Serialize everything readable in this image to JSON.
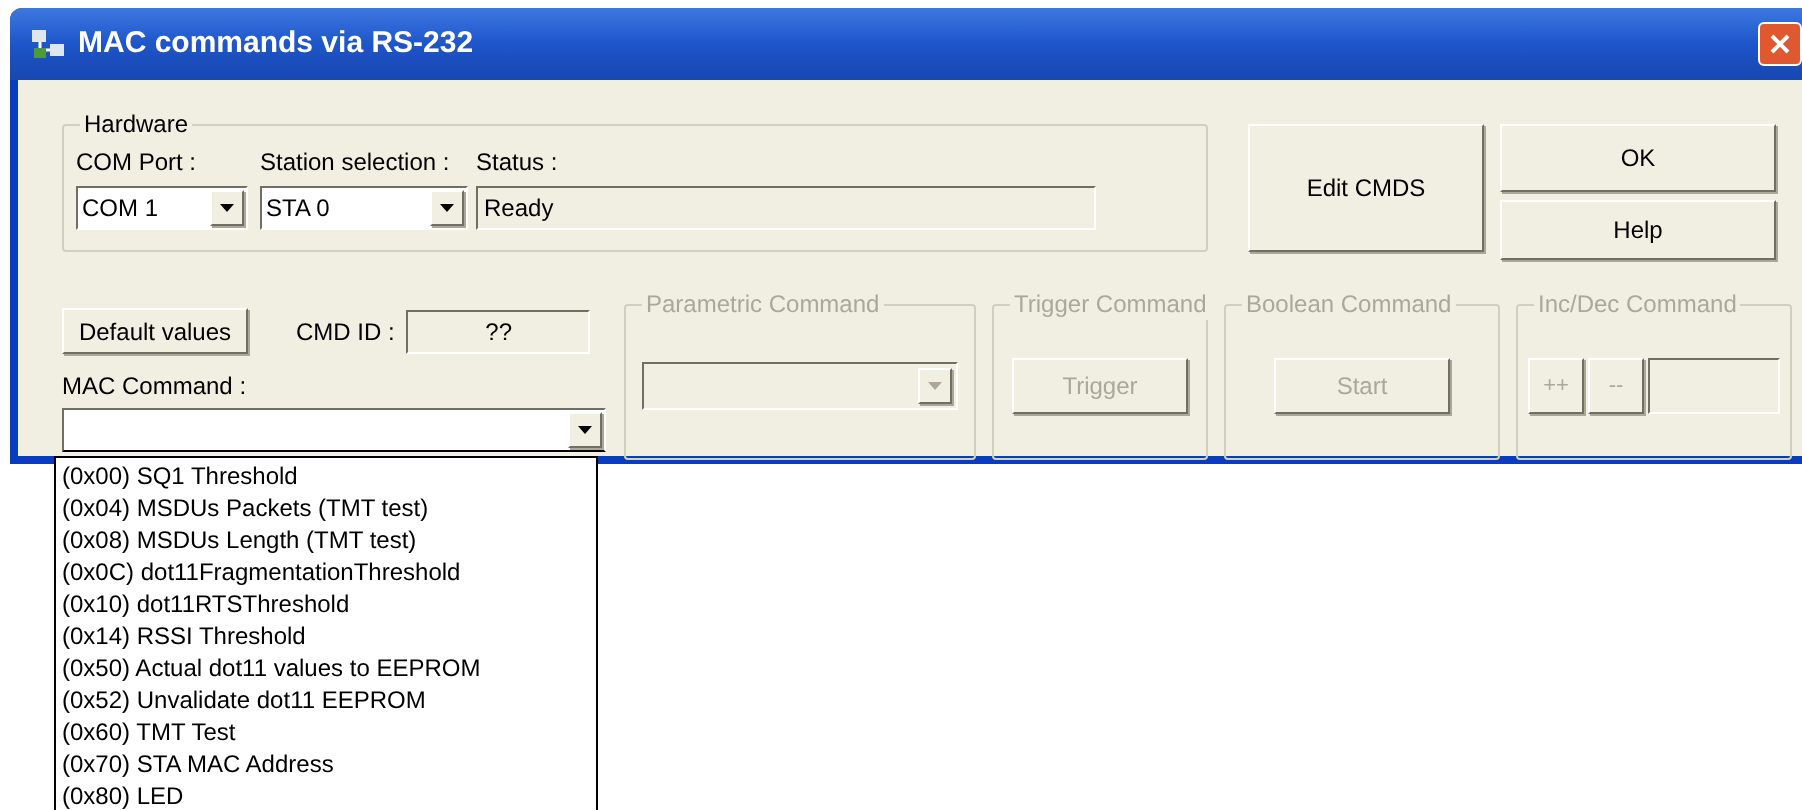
{
  "window": {
    "title": "MAC commands via RS-232"
  },
  "hardware": {
    "title": "Hardware",
    "com_port": {
      "label": "COM Port :",
      "value": "COM 1"
    },
    "station": {
      "label": "Station selection :",
      "value": "STA 0"
    },
    "status": {
      "label": "Status :",
      "value": "Ready"
    }
  },
  "buttons": {
    "edit": "Edit CMDS",
    "ok": "OK",
    "help": "Help",
    "default_values": "Default values"
  },
  "cmd_id": {
    "label": "CMD ID :",
    "value": "??"
  },
  "mac_command": {
    "label": "MAC Command :",
    "expanded": true,
    "options": [
      {
        "label": "(0x00) SQ1 Threshold"
      },
      {
        "label": "(0x04) MSDUs Packets (TMT test)"
      },
      {
        "label": "(0x08) MSDUs Length (TMT test)"
      },
      {
        "label": "(0x0C) dot11FragmentationThreshold"
      },
      {
        "label": "(0x10) dot11RTSThreshold"
      },
      {
        "label": "(0x14) RSSI Threshold"
      },
      {
        "label": "(0x50) Actual dot11 values to EEPROM"
      },
      {
        "label": "(0x52) Unvalidate dot11 EEPROM"
      },
      {
        "label": "(0x60) TMT Test"
      },
      {
        "label": "(0x70) STA MAC Address"
      },
      {
        "label": "(0x80) LED"
      }
    ]
  },
  "command_groups": [
    {
      "kind": "parametric",
      "title": "Parametric Command",
      "disabled": true
    },
    {
      "kind": "trigger",
      "title": "Trigger Command",
      "disabled": true,
      "button": "Trigger"
    },
    {
      "kind": "boolean",
      "title": "Boolean Command",
      "disabled": true,
      "button": "Start"
    },
    {
      "kind": "incdec",
      "title": "Inc/Dec Command",
      "disabled": true,
      "inc": "++",
      "dec": "--"
    }
  ]
}
